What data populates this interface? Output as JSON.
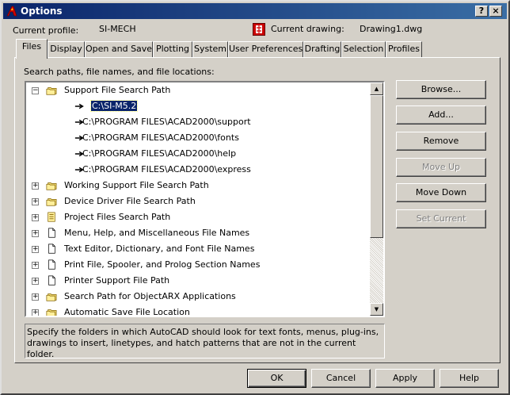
{
  "window": {
    "title": "Options",
    "help_glyph": "?",
    "close_glyph": "×"
  },
  "profile": {
    "label": "Current profile:",
    "value": "SI-MECH"
  },
  "drawing": {
    "label": "Current drawing:",
    "value": "Drawing1.dwg"
  },
  "tabs": [
    {
      "label": "Files"
    },
    {
      "label": "Display"
    },
    {
      "label": "Open and Save"
    },
    {
      "label": "Plotting"
    },
    {
      "label": "System"
    },
    {
      "label": "User Preferences"
    },
    {
      "label": "Drafting"
    },
    {
      "label": "Selection"
    },
    {
      "label": "Profiles"
    }
  ],
  "active_tab": "Files",
  "files": {
    "tree_label": "Search paths, file names, and file locations:",
    "tree": [
      {
        "text": "Support File Search Path",
        "expanded": true,
        "icon": "folder-stack-icon"
      },
      {
        "text": "C:\\SI-M5.2",
        "selected": true,
        "icon": "arrow-right-icon"
      },
      {
        "text": "C:\\PROGRAM FILES\\ACAD2000\\support",
        "icon": "arrow-right-icon"
      },
      {
        "text": "C:\\PROGRAM FILES\\ACAD2000\\fonts",
        "icon": "arrow-right-icon"
      },
      {
        "text": "C:\\PROGRAM FILES\\ACAD2000\\help",
        "icon": "arrow-right-icon"
      },
      {
        "text": "C:\\PROGRAM FILES\\ACAD2000\\express",
        "icon": "arrow-right-icon"
      },
      {
        "text": "Working Support File Search Path",
        "icon": "folder-stack-icon"
      },
      {
        "text": "Device Driver File Search Path",
        "icon": "folder-stack-icon"
      },
      {
        "text": "Project Files Search Path",
        "icon": "project-files-icon"
      },
      {
        "text": "Menu, Help, and Miscellaneous File Names",
        "icon": "document-icon"
      },
      {
        "text": "Text Editor, Dictionary, and Font File Names",
        "icon": "document-icon"
      },
      {
        "text": "Print File, Spooler, and Prolog Section Names",
        "icon": "document-icon"
      },
      {
        "text": "Printer Support File Path",
        "icon": "document-icon"
      },
      {
        "text": "Search Path for ObjectARX Applications",
        "icon": "folder-stack-icon"
      },
      {
        "text": "Automatic Save File Location",
        "icon": "folder-stack-icon"
      }
    ],
    "description": "Specify the folders in which AutoCAD should look for text fonts, menus, plug-ins, drawings to insert, linetypes, and hatch patterns that are not in the current folder.",
    "buttons": {
      "browse": "Browse...",
      "add": "Add...",
      "remove": "Remove",
      "move_up": "Move Up",
      "move_down": "Move Down",
      "set_current": "Set Current"
    }
  },
  "footer": {
    "ok": "OK",
    "cancel": "Cancel",
    "apply": "Apply",
    "help": "Help"
  },
  "colors": {
    "title_bar": "#0a246a",
    "selection": "#0a246a",
    "face": "#d4d0c8",
    "app_icon": "#cc0000"
  }
}
